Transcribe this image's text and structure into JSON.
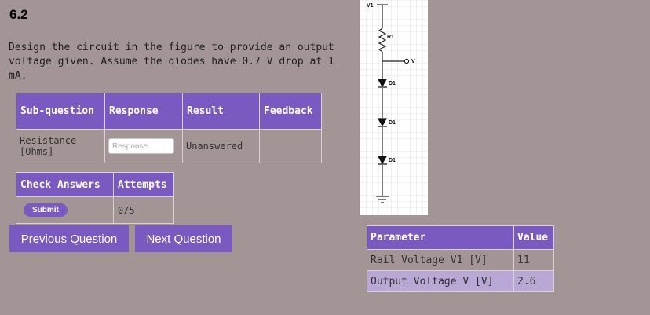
{
  "question": {
    "number": "6.2",
    "description": "Design the circuit in the figure to provide an output voltage given. Assume the diodes have 0.7 V drop at 1 mA."
  },
  "subquestion_table": {
    "headers": [
      "Sub-question",
      "Response",
      "Result",
      "Feedback"
    ],
    "rows": [
      {
        "subquestion": "Resistance [Ohms]",
        "response_value": "",
        "response_placeholder": "Response",
        "result": "Unanswered",
        "feedback": ""
      }
    ]
  },
  "check_table": {
    "headers": [
      "Check Answers",
      "Attempts"
    ],
    "submit_label": "Submit",
    "attempts": "0/5"
  },
  "navigation": {
    "previous_label": "Previous Question",
    "next_label": "Next Question"
  },
  "circuit": {
    "labels": {
      "v1": "V1",
      "r1": "R1",
      "v": "V",
      "d1a": "D1",
      "d1b": "D1",
      "d1c": "D1"
    }
  },
  "parameters": {
    "headers": [
      "Parameter",
      "Value"
    ],
    "rows": [
      {
        "name": "Rail Voltage V1 [V]",
        "value": "11"
      },
      {
        "name": "Output Voltage V [V]",
        "value": "2.6"
      }
    ]
  },
  "colors": {
    "background": "#a39595",
    "accent_purple": "#7a59c0",
    "highlight_row": "#b9a7d6"
  }
}
